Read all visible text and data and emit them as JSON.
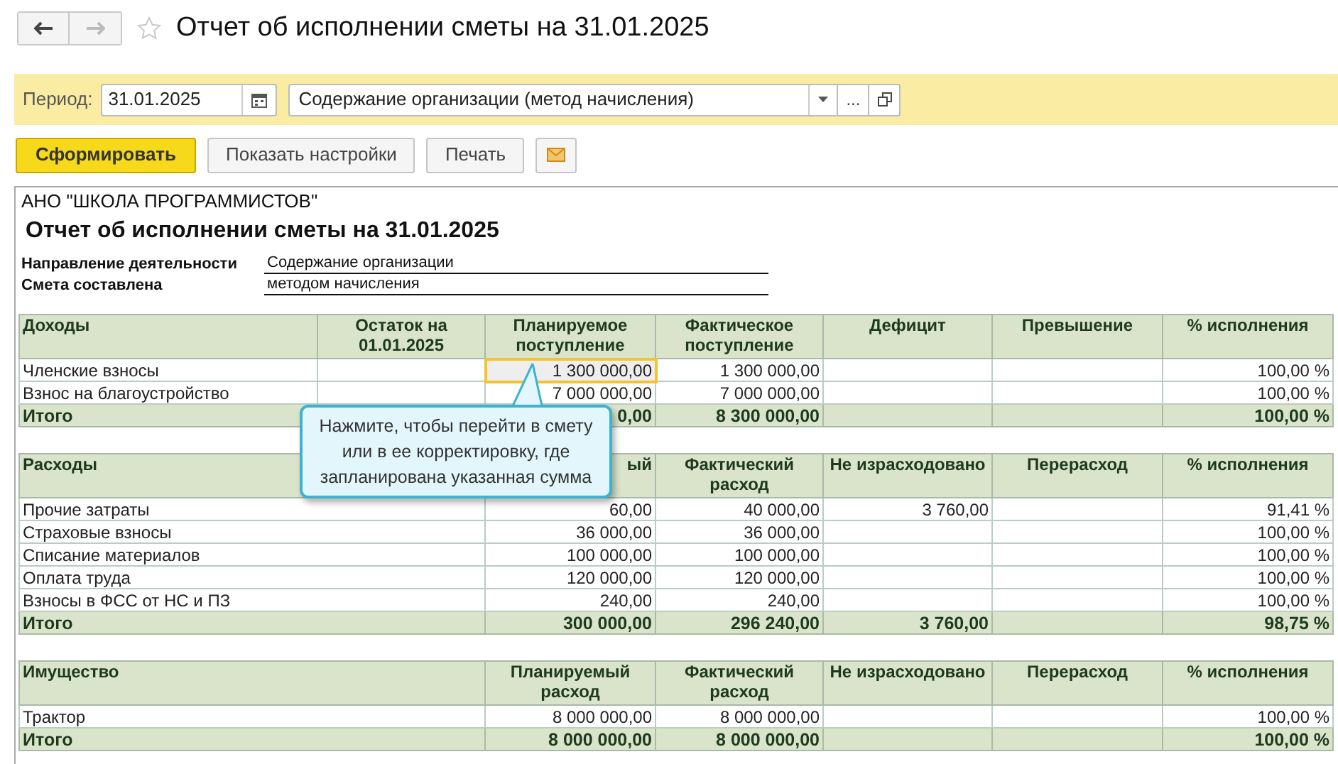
{
  "nav": {
    "back_disabled": false,
    "forward_disabled": true
  },
  "favorite": false,
  "title": "Отчет об исполнении сметы на 31.01.2025",
  "filter": {
    "label": "Период:",
    "date": "31.01.2025",
    "estimate": "Содержание организации (метод начисления)",
    "more_button": "..."
  },
  "actions": [
    {
      "kind": "primary",
      "label": "Сформировать"
    },
    {
      "kind": "normal",
      "label": "Показать настройки"
    },
    {
      "kind": "normal",
      "label": "Печать"
    },
    {
      "kind": "mail"
    }
  ],
  "report": {
    "organization": "АНО \"ШКОЛА ПРОГРАММИСТОВ\"",
    "title": "Отчет об исполнении сметы на 31.01.2025",
    "params": [
      {
        "label": "Направление деятельности",
        "value": "Содержание организации"
      },
      {
        "label": "Смета составлена",
        "value": "методом начисления"
      }
    ],
    "tables": [
      {
        "columns": [
          "Доходы",
          "Остаток на 01.01.2025",
          "Планируемое поступление",
          "Фактическое поступление",
          "Дефицит",
          "Превышение",
          "% исполнения"
        ],
        "rows": [
          {
            "kind": "data",
            "cells": [
              {
                "text": "Членские взносы",
                "selected": false
              },
              {
                "selected": false
              },
              {
                "text": "1 300 000,00",
                "selected": true
              },
              {
                "text": "1 300 000,00",
                "selected": false
              },
              {
                "selected": false
              },
              {
                "selected": false
              },
              {
                "text": "100,00 %",
                "selected": false
              }
            ]
          },
          {
            "kind": "data",
            "cells": [
              {
                "text": "Взнос на благоустройство",
                "selected": false
              },
              {
                "selected": false
              },
              {
                "text": "7 000 000,00",
                "selected": false
              },
              {
                "text": "7 000 000,00",
                "selected": false
              },
              {
                "selected": false
              },
              {
                "selected": false
              },
              {
                "text": "100,00 %",
                "selected": false
              }
            ]
          },
          {
            "kind": "total",
            "cells": [
              {
                "text": "Итого",
                "selected": false
              },
              {
                "selected": false
              },
              {
                "text": "0,00",
                "selected": false
              },
              {
                "text": "8 300 000,00",
                "selected": false
              },
              {
                "selected": false
              },
              {
                "selected": false
              },
              {
                "text": "100,00 %",
                "selected": false
              }
            ]
          }
        ]
      },
      {
        "columns": [
          "Расходы",
          "ый",
          "Фактический расход",
          "Не израсходовано",
          "Перерасход",
          "% исполнения"
        ],
        "rows": [
          {
            "kind": "data",
            "cells": [
              {
                "text": "Прочие затраты",
                "selected": false
              },
              {
                "text": "60,00",
                "selected": false
              },
              {
                "text": "40 000,00",
                "selected": false
              },
              {
                "text": "3 760,00",
                "selected": false
              },
              {
                "selected": false
              },
              {
                "text": "91,41 %",
                "selected": false
              }
            ]
          },
          {
            "kind": "data",
            "cells": [
              {
                "text": "Страховые взносы",
                "selected": false
              },
              {
                "text": "36 000,00",
                "selected": false
              },
              {
                "text": "36 000,00",
                "selected": false
              },
              {
                "selected": false
              },
              {
                "selected": false
              },
              {
                "text": "100,00 %",
                "selected": false
              }
            ]
          },
          {
            "kind": "data",
            "cells": [
              {
                "text": "Списание материалов",
                "selected": false
              },
              {
                "text": "100 000,00",
                "selected": false
              },
              {
                "text": "100 000,00",
                "selected": false
              },
              {
                "selected": false
              },
              {
                "selected": false
              },
              {
                "text": "100,00 %",
                "selected": false
              }
            ]
          },
          {
            "kind": "data",
            "cells": [
              {
                "text": "Оплата труда",
                "selected": false
              },
              {
                "text": "120 000,00",
                "selected": false
              },
              {
                "text": "120 000,00",
                "selected": false
              },
              {
                "selected": false
              },
              {
                "selected": false
              },
              {
                "text": "100,00 %",
                "selected": false
              }
            ]
          },
          {
            "kind": "data",
            "cells": [
              {
                "text": "Взносы в ФСС от НС и ПЗ",
                "selected": false
              },
              {
                "text": "240,00",
                "selected": false
              },
              {
                "text": "240,00",
                "selected": false
              },
              {
                "selected": false
              },
              {
                "selected": false
              },
              {
                "text": "100,00 %",
                "selected": false
              }
            ]
          },
          {
            "kind": "total",
            "cells": [
              {
                "text": "Итого",
                "selected": false
              },
              {
                "text": "300 000,00",
                "selected": false
              },
              {
                "text": "296 240,00",
                "selected": false
              },
              {
                "text": "3 760,00",
                "selected": false
              },
              {
                "selected": false
              },
              {
                "text": "98,75 %",
                "selected": false
              }
            ]
          }
        ]
      },
      {
        "columns": [
          "Имущество",
          "Планируемый расход",
          "Фактический расход",
          "Не израсходовано",
          "Перерасход",
          "% исполнения"
        ],
        "rows": [
          {
            "kind": "data",
            "cells": [
              {
                "text": "Трактор",
                "selected": false
              },
              {
                "text": "8 000 000,00",
                "selected": false
              },
              {
                "text": "8 000 000,00",
                "selected": false
              },
              {
                "selected": false
              },
              {
                "selected": false
              },
              {
                "text": "100,00 %",
                "selected": false
              }
            ]
          },
          {
            "kind": "total",
            "cells": [
              {
                "text": "Итого",
                "selected": false
              },
              {
                "text": "8 000 000,00",
                "selected": false
              },
              {
                "text": "8 000 000,00",
                "selected": false
              },
              {
                "selected": false
              },
              {
                "selected": false
              },
              {
                "text": "100,00 %",
                "selected": false
              }
            ]
          }
        ]
      }
    ]
  },
  "tooltip": "Нажмите, чтобы перейти в смету или в ее корректировку, где запланирована указанная сумма"
}
